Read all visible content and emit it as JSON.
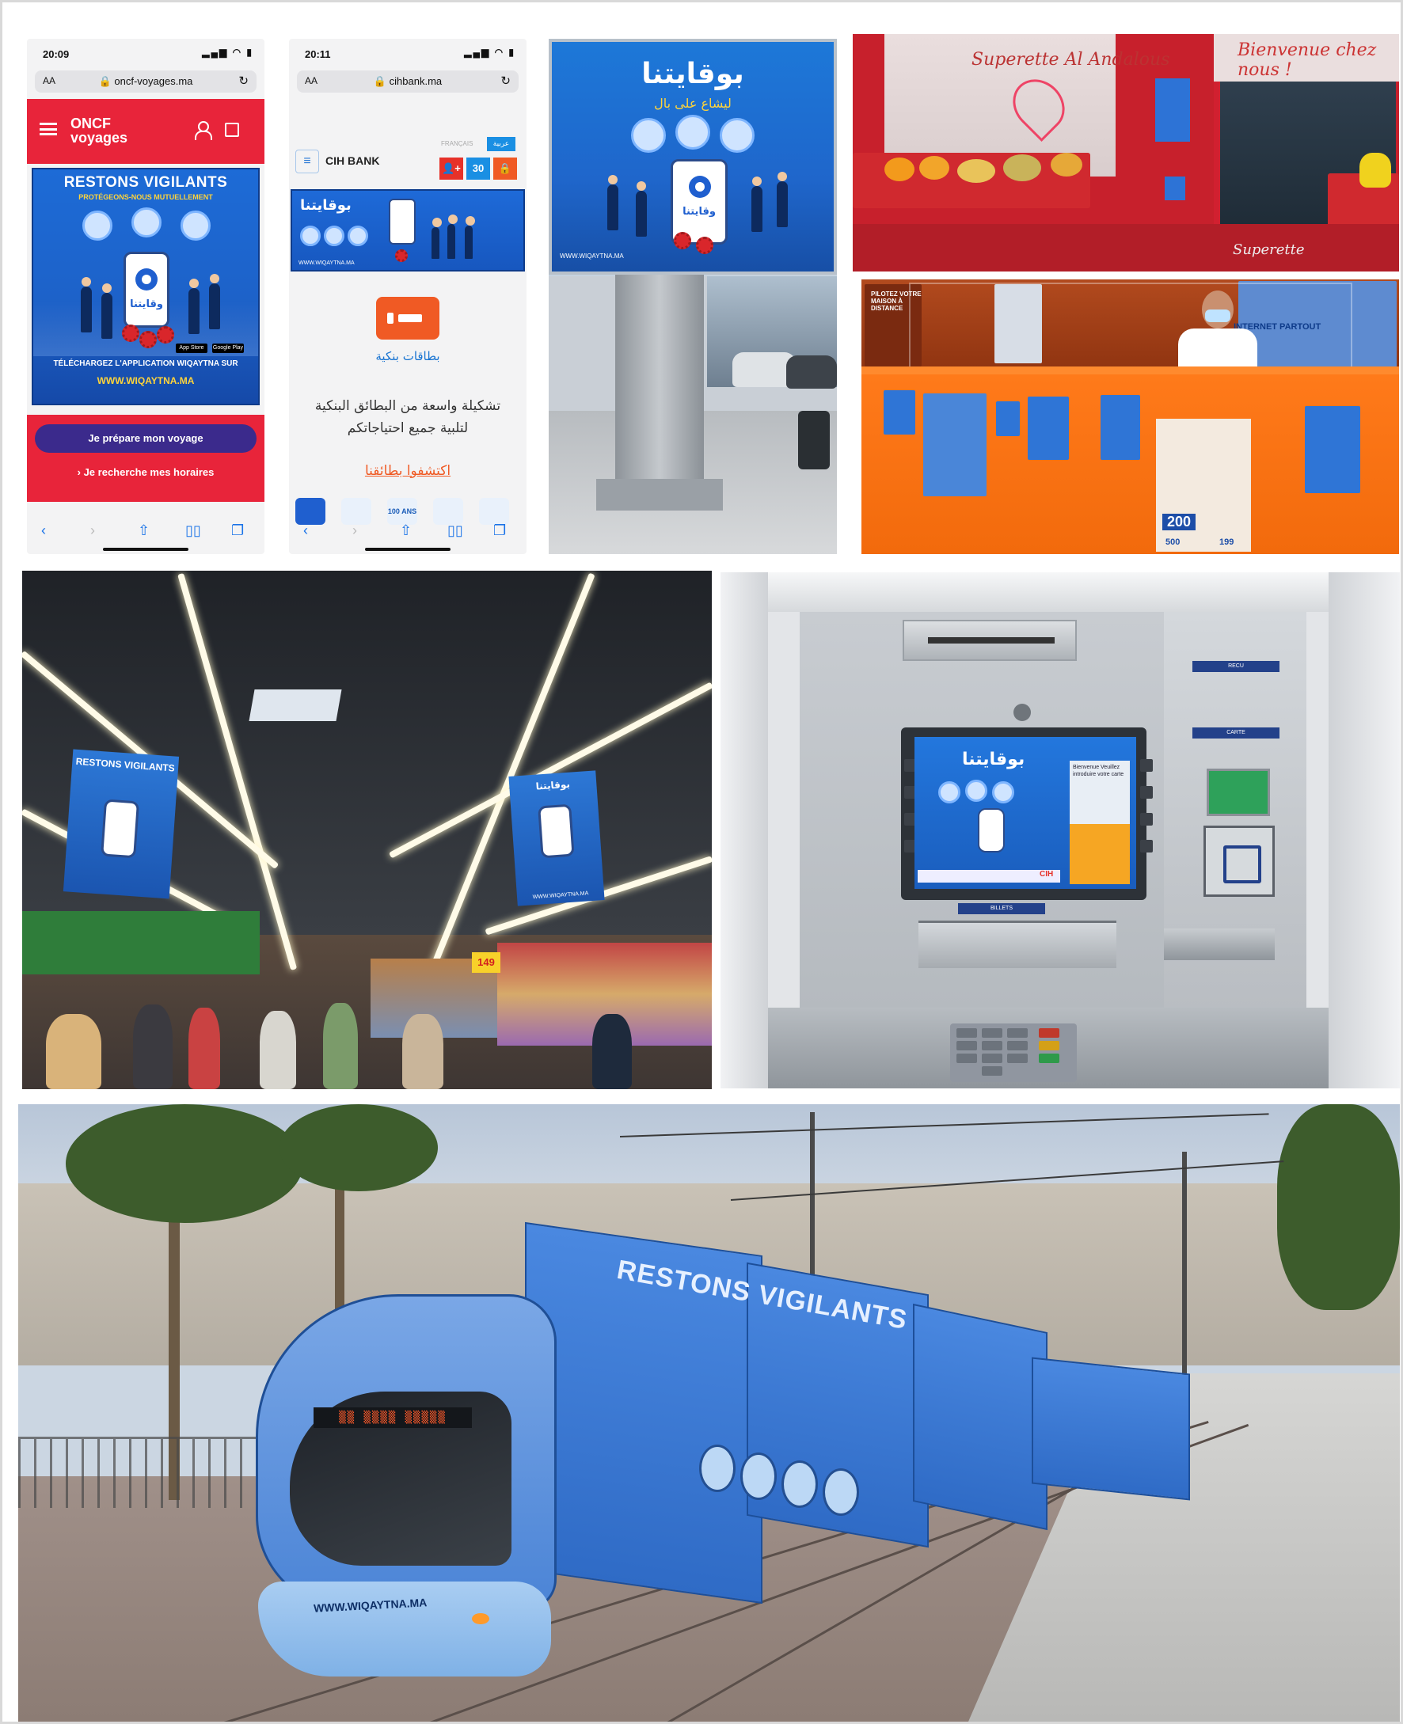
{
  "oncf": {
    "status_time": "20:09",
    "aa": "AA",
    "url": "oncf-voyages.ma",
    "logo_top": "ONCF",
    "logo_bottom": "voyages",
    "banner_title": "RESTONS VIGILANTS",
    "banner_sub": "PROTÉGEONS-NOUS MUTUELLEMENT",
    "app_name_ar": "وقايتنا",
    "download_text": "TÉLÉCHARGEZ L'APPLICATION WIQAYTNA SUR",
    "website": "WWW.WIQAYTNA.MA",
    "store_badges": [
      "App Store",
      "Google Play"
    ],
    "btn_prepare": "Je prépare mon voyage",
    "btn_schedule": "› Je recherche mes horaires"
  },
  "cih": {
    "status_time": "20:11",
    "aa": "AA",
    "url": "cihbank.ma",
    "logo": "CIH BANK",
    "lang_fr": "FRANÇAIS",
    "lang_ar": "عربية",
    "icon_30": "30",
    "banner_title_ar": "بوقايتنا",
    "banner_website": "WWW.WIQAYTNA.MA",
    "cards_label_ar": "بطاقات بنكية",
    "desc_ar_line1": "تشكيلة واسعة من البطائق البنكية",
    "desc_ar_line2": "لتلبية جميع احتياجاتكم",
    "discover_link_ar": "اكتشفوا بطائقنا",
    "tile_100": "100 ANS"
  },
  "billboard": {
    "title_ar": "بوقايتنا",
    "subtitle_ar": "ليشاع على بال",
    "app_name_ar": "وقايتنا",
    "website": "WWW.WIQAYTNA.MA"
  },
  "superette": {
    "sign": "Superette Al Andalous",
    "top_right": "Bienvenue chez nous !",
    "bottom_sign": "Superette"
  },
  "kiosk": {
    "top_left": "PILOTEZ VOTRE MAISON À DISTANCE",
    "internet_label": "INTERNET PARTOUT",
    "price_200": "200",
    "price_500": "500",
    "price_199": "199"
  },
  "supermarket": {
    "sign_left_title": "RESTONS VIGILANTS",
    "sign_right_title_ar": "بوقايتنا",
    "sign_right_website": "WWW.WIQAYTNA.MA",
    "price_tag": "149"
  },
  "atm": {
    "screen_title_ar": "بوقايتنا",
    "insert_text": "Bienvenue Veuillez introduire votre carte",
    "card_label": "RECU",
    "cash_label": "CARTE",
    "bills_label": "BILLETS",
    "brand": "CIH"
  },
  "tram": {
    "headline": "RESTONS VIGILANTS",
    "nose_url": "WWW.WIQAYTNA.MA"
  }
}
